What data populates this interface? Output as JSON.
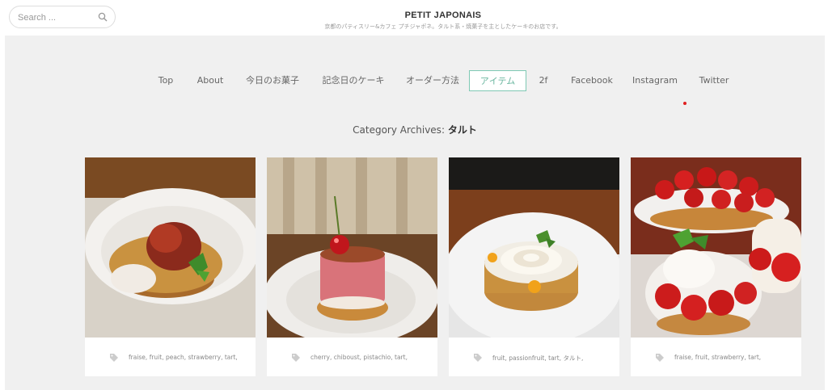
{
  "search": {
    "placeholder": "Search ..."
  },
  "brand": {
    "title": "PETIT JAPONAIS",
    "tagline": "京都のパティスリー&カフェ プチジャポネ。タルト系・焼菓子を主としたケーキのお店です。"
  },
  "nav": {
    "items": [
      {
        "label": "Top"
      },
      {
        "label": "About"
      },
      {
        "label": "今日のお菓子"
      },
      {
        "label": "記念日のケーキ"
      },
      {
        "label": "オーダー方法"
      },
      {
        "label": "アイテム",
        "active": true
      },
      {
        "label": "2f"
      },
      {
        "label": "Facebook"
      },
      {
        "label": "Instagram"
      },
      {
        "label": "Twitter"
      }
    ]
  },
  "archive": {
    "prefix": "Category Archives:",
    "category": "タルト"
  },
  "posts": [
    {
      "tags": "fraise, fruit, peach, strawberry, tart,",
      "image": "peach-strawberry-tart-photo"
    },
    {
      "tags": "cherry, chiboust, pistachio, tart,",
      "image": "cherry-mousse-cake-photo"
    },
    {
      "tags": "fruit, passionfruit, tart, タルト,",
      "image": "passionfruit-meringue-tart-photo"
    },
    {
      "tags": "fraise, fruit, strawberry, tart,",
      "image": "strawberry-tart-photo"
    }
  ],
  "colors": {
    "accent": "#6bb7a0",
    "background": "#f0f0f0",
    "indicator": "#e02020"
  }
}
